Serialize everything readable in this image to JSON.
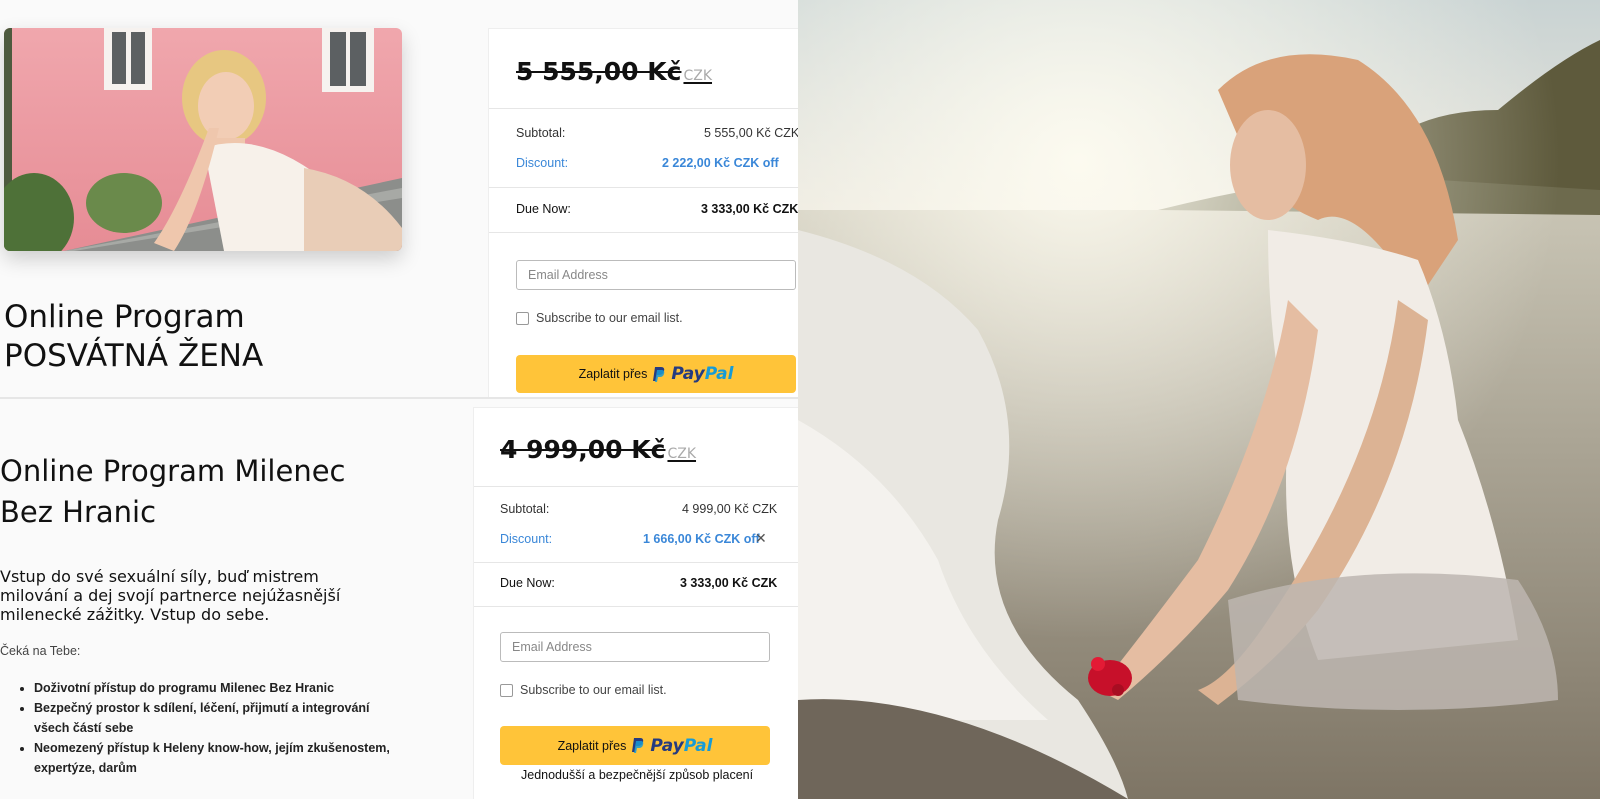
{
  "top": {
    "title_line1": "Online Program",
    "title_line2": "POSVÁTNÁ ŽENA",
    "price": "5 555,00 Kč",
    "currency": "CZK",
    "subtotal_label": "Subtotal:",
    "subtotal_value": "5 555,00 Kč CZK",
    "discount_label": "Discount:",
    "discount_value": "2 222,00 Kč CZK off",
    "due_label": "Due Now:",
    "due_value": "3 333,00 Kč CZK",
    "email_placeholder": "Email Address",
    "subscribe_label": "Subscribe to our email list.",
    "pay_label": "Zaplatit přes",
    "paypal_pay": "Pay",
    "paypal_pal": "Pal"
  },
  "bottom": {
    "title_line1": "Online Program Milenec",
    "title_line2": "Bez Hranic",
    "description": "Vstup do své sexuální síly, buď mistrem milování a dej svojí partnerce nejúžasnější milenecké zážitky. Vstup do sebe.",
    "awaits": "Čeká na Tebe:",
    "bullets": [
      "Doživotní přístup do programu Milenec Bez Hranic",
      "Bezpečný prostor k sdílení, léčení, přijmutí a integrování všech částí sebe",
      "Neomezený přístup k Heleny know-how, jejím zkušenostem, expertýze, darům"
    ],
    "price": "4 999,00 Kč",
    "currency": "CZK",
    "subtotal_label": "Subtotal:",
    "subtotal_value": "4 999,00 Kč CZK",
    "discount_label": "Discount:",
    "discount_value": "1 666,00 Kč CZK off",
    "remove_discount": "✕",
    "due_label": "Due Now:",
    "due_value": "3 333,00 Kč CZK",
    "email_placeholder": "Email Address",
    "subscribe_label": "Subscribe to our email list.",
    "pay_label": "Zaplatit přes",
    "paypal_pay": "Pay",
    "paypal_pal": "Pal",
    "paypal_tagline": "Jednodušší a bezpečnější způsob placení"
  },
  "colors": {
    "paypal_yellow": "#ffc439",
    "discount_blue": "#3a87d8",
    "paypal_dark": "#253b80",
    "paypal_light": "#179bd7"
  }
}
